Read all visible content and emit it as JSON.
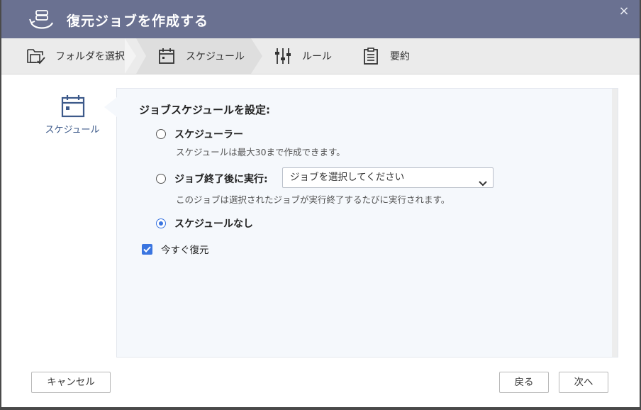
{
  "dialog": {
    "title": "復元ジョブを作成する",
    "close_label": "×"
  },
  "steps": [
    {
      "label": "フォルダを選択",
      "icon": "folder-check-icon"
    },
    {
      "label": "スケジュール",
      "icon": "calendar-icon",
      "active": true
    },
    {
      "label": "ルール",
      "icon": "sliders-icon"
    },
    {
      "label": "要約",
      "icon": "clipboard-icon"
    }
  ],
  "leftnav": {
    "label": "スケジュール",
    "icon": "calendar-icon"
  },
  "main": {
    "heading": "ジョブスケジュールを設定:",
    "options": [
      {
        "label": "スケジューラー",
        "desc": "スケジュールは最大30まで作成できます。",
        "checked": false
      },
      {
        "label": "ジョブ終了後に実行:",
        "desc": "このジョブは選択されたジョブが実行終了するたびに実行されます。",
        "checked": false
      },
      {
        "label": "スケジュールなし",
        "desc": "",
        "checked": true
      }
    ],
    "job_select_value": "ジョブを選択してください",
    "restore_now_label": "今すぐ復元",
    "restore_now_checked": true
  },
  "footer": {
    "cancel": "キャンセル",
    "back": "戻る",
    "next": "次へ"
  },
  "colors": {
    "titlebar": "#6a7191",
    "accent": "#3a75e0",
    "nav_text": "#3d5a8a"
  }
}
